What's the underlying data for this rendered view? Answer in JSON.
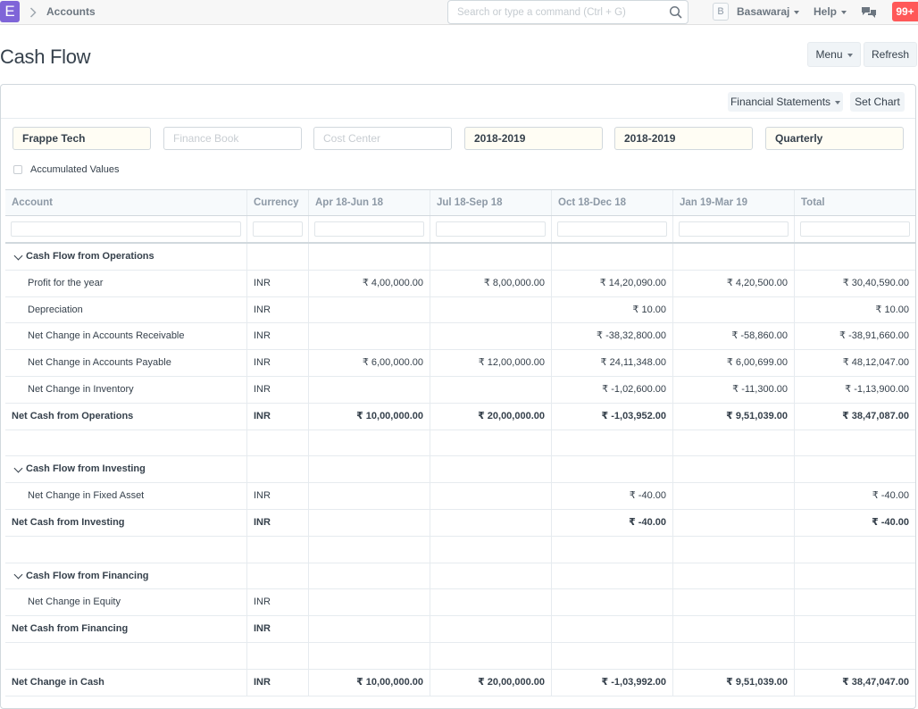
{
  "navbar": {
    "logo": "E",
    "breadcrumb": "Accounts",
    "search_placeholder": "Search or type a command (Ctrl + G)",
    "avatar_initial": "B",
    "user_name": "Basawaraj",
    "help_label": "Help",
    "notification_count": "99+"
  },
  "page": {
    "title": "Cash Flow",
    "menu_label": "Menu",
    "refresh_label": "Refresh"
  },
  "toolbar": {
    "financial_statements_label": "Financial Statements",
    "set_chart_label": "Set Chart"
  },
  "filters": {
    "company": "Frappe Tech",
    "finance_book_placeholder": "Finance Book",
    "cost_center_placeholder": "Cost Center",
    "from_fiscal_year": "2018-2019",
    "to_fiscal_year": "2018-2019",
    "periodicity": "Quarterly",
    "accumulated_values_label": "Accumulated Values"
  },
  "table": {
    "columns": [
      "Account",
      "Currency",
      "Apr 18-Jun 18",
      "Jul 18-Sep 18",
      "Oct 18-Dec 18",
      "Jan 19-Mar 19",
      "Total"
    ],
    "rows": [
      {
        "type": "group",
        "cells": [
          "Cash Flow from Operations",
          "",
          "",
          "",
          "",
          "",
          ""
        ]
      },
      {
        "type": "item",
        "cells": [
          "Profit for the year",
          "INR",
          "₹ 4,00,000.00",
          "₹ 8,00,000.00",
          "₹ 14,20,090.00",
          "₹ 4,20,500.00",
          "₹ 30,40,590.00"
        ]
      },
      {
        "type": "item",
        "cells": [
          "Depreciation",
          "INR",
          "",
          "",
          "₹ 10.00",
          "",
          "₹ 10.00"
        ]
      },
      {
        "type": "item",
        "cells": [
          "Net Change in Accounts Receivable",
          "INR",
          "",
          "",
          "₹ -38,32,800.00",
          "₹ -58,860.00",
          "₹ -38,91,660.00"
        ]
      },
      {
        "type": "item",
        "cells": [
          "Net Change in Accounts Payable",
          "INR",
          "₹ 6,00,000.00",
          "₹ 12,00,000.00",
          "₹ 24,11,348.00",
          "₹ 6,00,699.00",
          "₹ 48,12,047.00"
        ]
      },
      {
        "type": "item",
        "cells": [
          "Net Change in Inventory",
          "INR",
          "",
          "",
          "₹ -1,02,600.00",
          "₹ -11,300.00",
          "₹ -1,13,900.00"
        ]
      },
      {
        "type": "total",
        "cells": [
          "Net Cash from Operations",
          "INR",
          "₹ 10,00,000.00",
          "₹ 20,00,000.00",
          "₹ -1,03,952.00",
          "₹ 9,51,039.00",
          "₹ 38,47,087.00"
        ]
      },
      {
        "type": "blank",
        "cells": [
          "",
          "",
          "",
          "",
          "",
          "",
          ""
        ]
      },
      {
        "type": "group",
        "cells": [
          "Cash Flow from Investing",
          "",
          "",
          "",
          "",
          "",
          ""
        ]
      },
      {
        "type": "item",
        "cells": [
          "Net Change in Fixed Asset",
          "INR",
          "",
          "",
          "₹ -40.00",
          "",
          "₹ -40.00"
        ]
      },
      {
        "type": "total",
        "cells": [
          "Net Cash from Investing",
          "INR",
          "",
          "",
          "₹ -40.00",
          "",
          "₹ -40.00"
        ]
      },
      {
        "type": "blank",
        "cells": [
          "",
          "",
          "",
          "",
          "",
          "",
          ""
        ]
      },
      {
        "type": "group",
        "cells": [
          "Cash Flow from Financing",
          "",
          "",
          "",
          "",
          "",
          ""
        ]
      },
      {
        "type": "item",
        "cells": [
          "Net Change in Equity",
          "INR",
          "",
          "",
          "",
          "",
          ""
        ]
      },
      {
        "type": "total",
        "cells": [
          "Net Cash from Financing",
          "INR",
          "",
          "",
          "",
          "",
          ""
        ]
      },
      {
        "type": "blank",
        "cells": [
          "",
          "",
          "",
          "",
          "",
          "",
          ""
        ]
      },
      {
        "type": "total",
        "cells": [
          "Net Change in Cash",
          "INR",
          "₹ 10,00,000.00",
          "₹ 20,00,000.00",
          "₹ -1,03,992.00",
          "₹ 9,51,039.00",
          "₹ 38,47,047.00"
        ]
      }
    ]
  },
  "colors": {
    "brand": "#7f65d8",
    "notification": "#ff5858"
  }
}
